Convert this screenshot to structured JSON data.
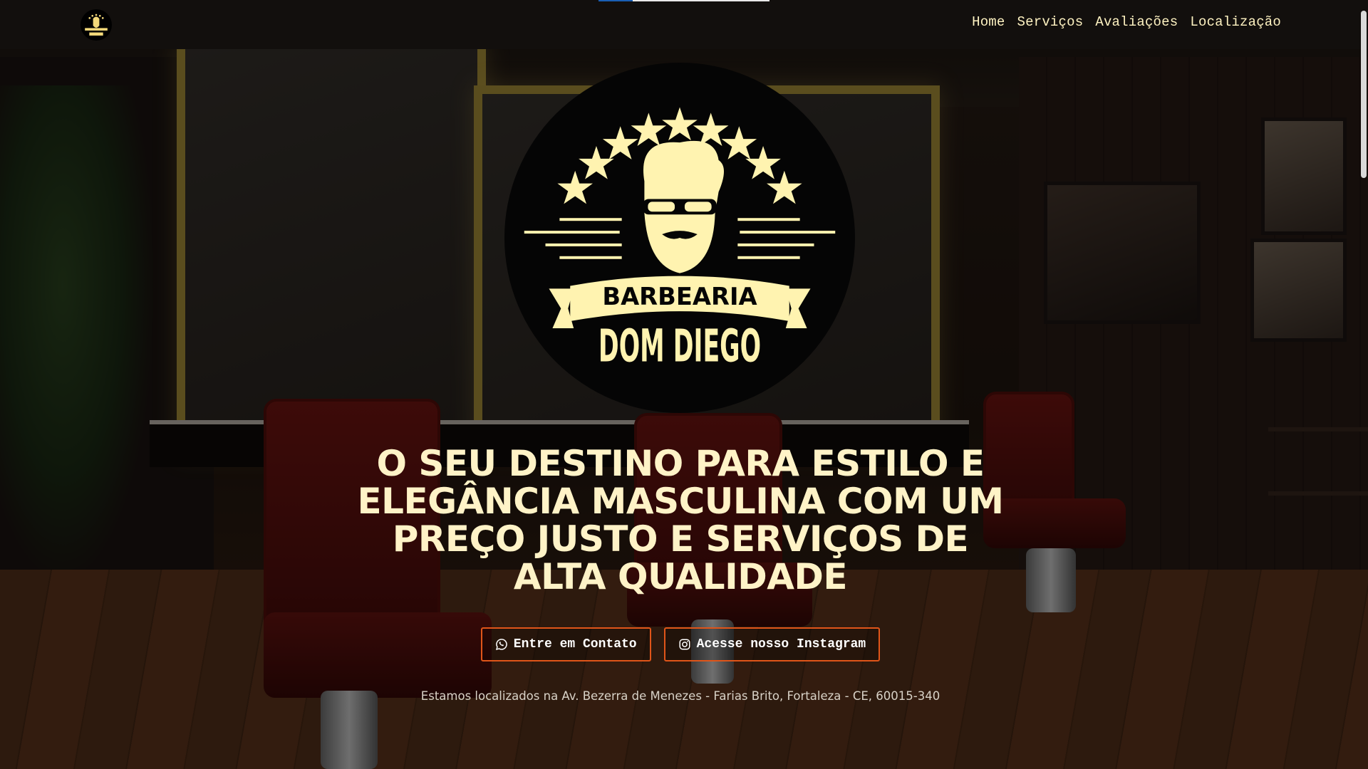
{
  "nav": {
    "logo_alt": "Barbearia Dom Diego",
    "links": [
      "Home",
      "Serviços",
      "Avaliações",
      "Localização"
    ]
  },
  "logo": {
    "top_text": "BARBEARIA",
    "bottom_text": "DOM DIEGO",
    "colors": {
      "disc": "#050505",
      "gold": "#fff3b0"
    }
  },
  "hero": {
    "headline": "O SEU DESTINO PARA ESTILO E ELEGÂNCIA MASCULINA COM UM PREÇO JUSTO E SERVIÇOS DE ALTA QUALIDADE",
    "buttons": [
      {
        "label": "Entre em Contato",
        "icon": "whatsapp-icon"
      },
      {
        "label": "Acesse nosso Instagram",
        "icon": "instagram-icon"
      }
    ],
    "address": "Estamos localizados na Av. Bezerra de Menezes - Farias Brito, Fortaleza - CE, 60015-340"
  },
  "colors": {
    "accent": "#e05519",
    "cream": "#fff3c2",
    "navbar": "#120f0d"
  }
}
